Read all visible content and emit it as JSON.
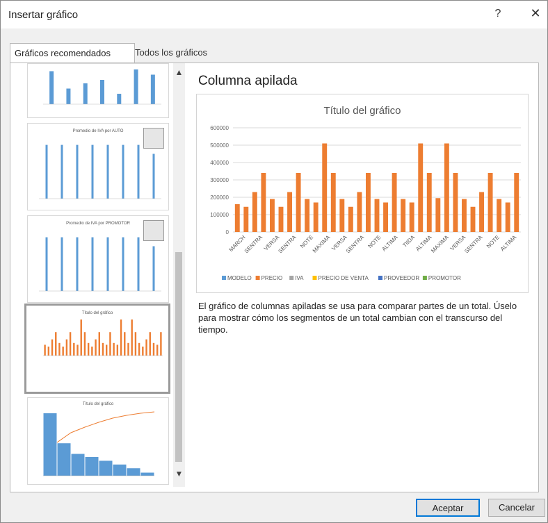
{
  "dialog": {
    "title": "Insertar gráfico",
    "help_label": "?",
    "close_label": "✕"
  },
  "tabs": [
    {
      "label": "Gráficos recomendados",
      "active": true
    },
    {
      "label": "Todos los gráficos",
      "active": false
    }
  ],
  "thumbnails": [
    {
      "title": ""
    },
    {
      "title": "Promedio de IVA por AUTO"
    },
    {
      "title": "Promedio de IVA por PROMOTOR"
    },
    {
      "title": "Título del gráfico"
    },
    {
      "title": "Título del gráfico"
    }
  ],
  "preview": {
    "chart_name": "Columna apilada",
    "description": "El gráfico de columnas apiladas se usa para comparar partes de un total. Úselo para mostrar cómo los segmentos de un total cambian con el transcurso del tiempo."
  },
  "chart_data": {
    "type": "bar",
    "title": "Título del gráfico",
    "categories": [
      "MARCH",
      "SENTRA",
      "VERSA",
      "SENTRA",
      "NOTE",
      "MAXIMA",
      "VERSA",
      "SENTRA",
      "NOTE",
      "ALTIMA",
      "TIIDA",
      "ALTIMA",
      "MAXIMA",
      "VERSA",
      "SENTRA",
      "NOTE",
      "ALTIMA"
    ],
    "tick_labels": [
      "0",
      "100000",
      "200000",
      "300000",
      "400000",
      "500000",
      "600000"
    ],
    "ylim": [
      0,
      600000
    ],
    "series": [
      {
        "name": "MODELO",
        "values": []
      },
      {
        "name": "PRECIO",
        "values": [
          160000,
          145000,
          230000,
          340000,
          190000,
          145000,
          230000,
          340000,
          190000,
          170000,
          510000,
          340000,
          190000,
          145000,
          230000,
          340000,
          190000,
          170000,
          340000,
          190000,
          170000,
          510000,
          340000,
          195000,
          510000,
          340000,
          190000,
          145000,
          230000,
          340000,
          190000,
          170000,
          340000
        ]
      },
      {
        "name": "IVA",
        "values": []
      },
      {
        "name": "PRECIO DE VENTA",
        "values": []
      },
      {
        "name": "PROVEEDOR",
        "values": []
      },
      {
        "name": "PROMOTOR",
        "values": []
      }
    ],
    "legend_position": "bottom",
    "grid": true,
    "colors": {
      "MODELO": "#5b9bd5",
      "PRECIO": "#ed7d31",
      "IVA": "#a5a5a5",
      "PRECIO DE VENTA": "#ffc000",
      "PROVEEDOR": "#4472c4",
      "PROMOTOR": "#70ad47"
    }
  },
  "buttons": {
    "ok_label": "Aceptar",
    "cancel_label": "Cancelar"
  },
  "colors": {
    "accent": "#0078d7",
    "bar_orange": "#ed7d31",
    "bar_blue": "#5b9bd5"
  },
  "icons": [
    "help-icon",
    "close-icon",
    "chevron-up-icon",
    "chevron-down-icon",
    "swap-rows-columns-icon"
  ]
}
